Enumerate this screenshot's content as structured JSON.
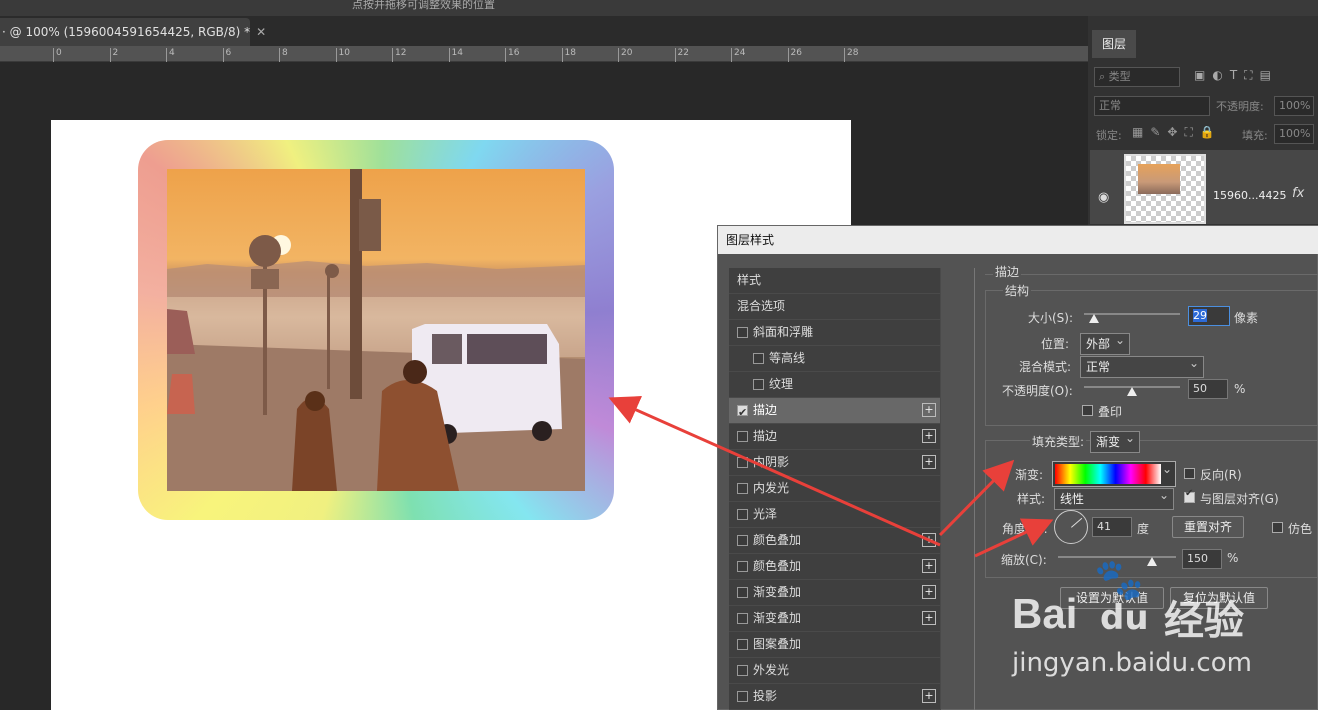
{
  "app": {
    "top_hint": "点按并拖移可调整效果的位置",
    "doc_tab": "· @ 100% (1596004591654425, RGB/8) *",
    "doc_close": "✕"
  },
  "ruler": [
    "0",
    "2",
    "4",
    "6",
    "8",
    "10",
    "12",
    "14",
    "16",
    "18",
    "20",
    "22",
    "24",
    "26",
    "28"
  ],
  "layers_panel": {
    "tab": "图层",
    "filter_placeholder": "类型",
    "blend_mode": "正常",
    "opacity_label": "不透明度:",
    "opacity": "100%",
    "lock_label": "锁定:",
    "fill_label": "填充:",
    "fill": "100%",
    "layer_name": "15960...4425",
    "fx": "fx"
  },
  "dialog": {
    "title": "图层样式",
    "styles": [
      {
        "label": "样式",
        "checkbox": false,
        "checked": false,
        "plus": false
      },
      {
        "label": "混合选项",
        "checkbox": false,
        "checked": false,
        "plus": false
      },
      {
        "label": "斜面和浮雕",
        "checkbox": true,
        "checked": false,
        "plus": false
      },
      {
        "label": "等高线",
        "checkbox": true,
        "checked": false,
        "plus": false,
        "indent": true
      },
      {
        "label": "纹理",
        "checkbox": true,
        "checked": false,
        "plus": false,
        "indent": true
      },
      {
        "label": "描边",
        "checkbox": true,
        "checked": true,
        "plus": true,
        "active": true
      },
      {
        "label": "描边",
        "checkbox": true,
        "checked": false,
        "plus": true
      },
      {
        "label": "内阴影",
        "checkbox": true,
        "checked": false,
        "plus": true
      },
      {
        "label": "内发光",
        "checkbox": true,
        "checked": false,
        "plus": false
      },
      {
        "label": "光泽",
        "checkbox": true,
        "checked": false,
        "plus": false
      },
      {
        "label": "颜色叠加",
        "checkbox": true,
        "checked": false,
        "plus": true
      },
      {
        "label": "颜色叠加",
        "checkbox": true,
        "checked": false,
        "plus": true
      },
      {
        "label": "渐变叠加",
        "checkbox": true,
        "checked": false,
        "plus": true
      },
      {
        "label": "渐变叠加",
        "checkbox": true,
        "checked": false,
        "plus": true
      },
      {
        "label": "图案叠加",
        "checkbox": true,
        "checked": false,
        "plus": false
      },
      {
        "label": "外发光",
        "checkbox": true,
        "checked": false,
        "plus": false
      },
      {
        "label": "投影",
        "checkbox": true,
        "checked": false,
        "plus": true
      }
    ],
    "stroke": {
      "section": "描边",
      "structure": "结构",
      "size_label": "大小(S):",
      "size": "29",
      "size_unit": "像素",
      "size_level": 0.1,
      "position_label": "位置:",
      "position": "外部",
      "blend_label": "混合模式:",
      "blend": "正常",
      "opacity_label": "不透明度(O):",
      "opacity": "50",
      "opacity_unit": "%",
      "opacity_level": 0.5,
      "overprint": "叠印",
      "fill_type_label": "填充类型:",
      "fill_type": "渐变",
      "gradient_label": "渐变:",
      "reverse": "反向(R)",
      "style_label": "样式:",
      "style": "线性",
      "align": "与图层对齐(G)",
      "angle_label": "角度(A):",
      "angle": "41",
      "angle_unit": "度",
      "reset_align": "重置对齐",
      "dither": "仿色",
      "scale_label": "缩放(C):",
      "scale": "150",
      "scale_unit": "%",
      "scale_level": 0.8,
      "set_default": "设置为默认值",
      "reset_default": "复位为默认值"
    }
  },
  "watermark": {
    "brand": "Bai",
    "paw": "du",
    "cn": "经验",
    "url": "jingyan.baidu.com"
  },
  "colors": {
    "arrow": "#e8403a",
    "accent": "#2d6bd8"
  }
}
